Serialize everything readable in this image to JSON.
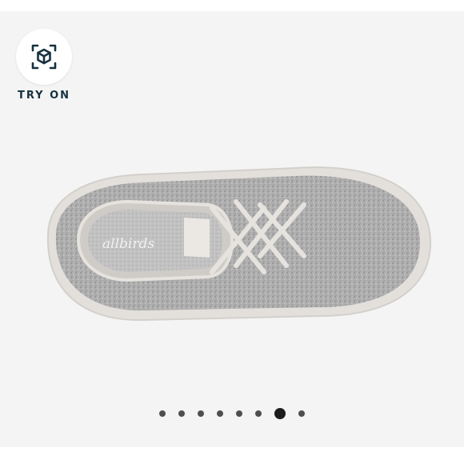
{
  "try_on": {
    "label": "TRY ON",
    "icon": "ar-cube-icon"
  },
  "product": {
    "brand_on_insole": "allbirds",
    "image": "gray-wool-runner-sneaker-top-view"
  },
  "carousel": {
    "total_slides": 8,
    "active_index": 6
  },
  "colors": {
    "background": "#f4f4f4",
    "label": "#16313f",
    "dot": "#4e4e4e",
    "dot_active": "#1c1c1c"
  }
}
